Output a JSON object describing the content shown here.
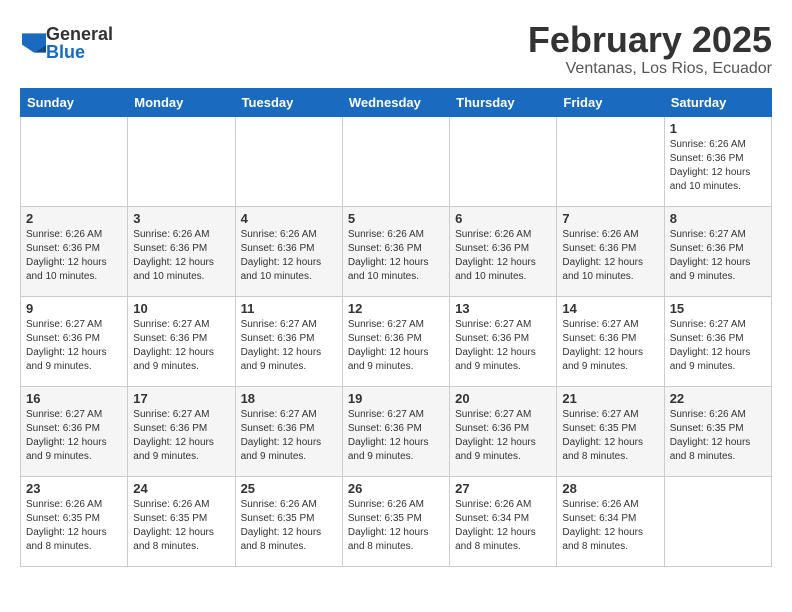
{
  "logo": {
    "general": "General",
    "blue": "Blue"
  },
  "title": "February 2025",
  "subtitle": "Ventanas, Los Rios, Ecuador",
  "days_of_week": [
    "Sunday",
    "Monday",
    "Tuesday",
    "Wednesday",
    "Thursday",
    "Friday",
    "Saturday"
  ],
  "weeks": [
    [
      {
        "day": "",
        "info": ""
      },
      {
        "day": "",
        "info": ""
      },
      {
        "day": "",
        "info": ""
      },
      {
        "day": "",
        "info": ""
      },
      {
        "day": "",
        "info": ""
      },
      {
        "day": "",
        "info": ""
      },
      {
        "day": "1",
        "info": "Sunrise: 6:26 AM\nSunset: 6:36 PM\nDaylight: 12 hours\nand 10 minutes."
      }
    ],
    [
      {
        "day": "2",
        "info": "Sunrise: 6:26 AM\nSunset: 6:36 PM\nDaylight: 12 hours\nand 10 minutes."
      },
      {
        "day": "3",
        "info": "Sunrise: 6:26 AM\nSunset: 6:36 PM\nDaylight: 12 hours\nand 10 minutes."
      },
      {
        "day": "4",
        "info": "Sunrise: 6:26 AM\nSunset: 6:36 PM\nDaylight: 12 hours\nand 10 minutes."
      },
      {
        "day": "5",
        "info": "Sunrise: 6:26 AM\nSunset: 6:36 PM\nDaylight: 12 hours\nand 10 minutes."
      },
      {
        "day": "6",
        "info": "Sunrise: 6:26 AM\nSunset: 6:36 PM\nDaylight: 12 hours\nand 10 minutes."
      },
      {
        "day": "7",
        "info": "Sunrise: 6:26 AM\nSunset: 6:36 PM\nDaylight: 12 hours\nand 10 minutes."
      },
      {
        "day": "8",
        "info": "Sunrise: 6:27 AM\nSunset: 6:36 PM\nDaylight: 12 hours\nand 9 minutes."
      }
    ],
    [
      {
        "day": "9",
        "info": "Sunrise: 6:27 AM\nSunset: 6:36 PM\nDaylight: 12 hours\nand 9 minutes."
      },
      {
        "day": "10",
        "info": "Sunrise: 6:27 AM\nSunset: 6:36 PM\nDaylight: 12 hours\nand 9 minutes."
      },
      {
        "day": "11",
        "info": "Sunrise: 6:27 AM\nSunset: 6:36 PM\nDaylight: 12 hours\nand 9 minutes."
      },
      {
        "day": "12",
        "info": "Sunrise: 6:27 AM\nSunset: 6:36 PM\nDaylight: 12 hours\nand 9 minutes."
      },
      {
        "day": "13",
        "info": "Sunrise: 6:27 AM\nSunset: 6:36 PM\nDaylight: 12 hours\nand 9 minutes."
      },
      {
        "day": "14",
        "info": "Sunrise: 6:27 AM\nSunset: 6:36 PM\nDaylight: 12 hours\nand 9 minutes."
      },
      {
        "day": "15",
        "info": "Sunrise: 6:27 AM\nSunset: 6:36 PM\nDaylight: 12 hours\nand 9 minutes."
      }
    ],
    [
      {
        "day": "16",
        "info": "Sunrise: 6:27 AM\nSunset: 6:36 PM\nDaylight: 12 hours\nand 9 minutes."
      },
      {
        "day": "17",
        "info": "Sunrise: 6:27 AM\nSunset: 6:36 PM\nDaylight: 12 hours\nand 9 minutes."
      },
      {
        "day": "18",
        "info": "Sunrise: 6:27 AM\nSunset: 6:36 PM\nDaylight: 12 hours\nand 9 minutes."
      },
      {
        "day": "19",
        "info": "Sunrise: 6:27 AM\nSunset: 6:36 PM\nDaylight: 12 hours\nand 9 minutes."
      },
      {
        "day": "20",
        "info": "Sunrise: 6:27 AM\nSunset: 6:36 PM\nDaylight: 12 hours\nand 9 minutes."
      },
      {
        "day": "21",
        "info": "Sunrise: 6:27 AM\nSunset: 6:35 PM\nDaylight: 12 hours\nand 8 minutes."
      },
      {
        "day": "22",
        "info": "Sunrise: 6:26 AM\nSunset: 6:35 PM\nDaylight: 12 hours\nand 8 minutes."
      }
    ],
    [
      {
        "day": "23",
        "info": "Sunrise: 6:26 AM\nSunset: 6:35 PM\nDaylight: 12 hours\nand 8 minutes."
      },
      {
        "day": "24",
        "info": "Sunrise: 6:26 AM\nSunset: 6:35 PM\nDaylight: 12 hours\nand 8 minutes."
      },
      {
        "day": "25",
        "info": "Sunrise: 6:26 AM\nSunset: 6:35 PM\nDaylight: 12 hours\nand 8 minutes."
      },
      {
        "day": "26",
        "info": "Sunrise: 6:26 AM\nSunset: 6:35 PM\nDaylight: 12 hours\nand 8 minutes."
      },
      {
        "day": "27",
        "info": "Sunrise: 6:26 AM\nSunset: 6:34 PM\nDaylight: 12 hours\nand 8 minutes."
      },
      {
        "day": "28",
        "info": "Sunrise: 6:26 AM\nSunset: 6:34 PM\nDaylight: 12 hours\nand 8 minutes."
      },
      {
        "day": "",
        "info": ""
      }
    ]
  ]
}
